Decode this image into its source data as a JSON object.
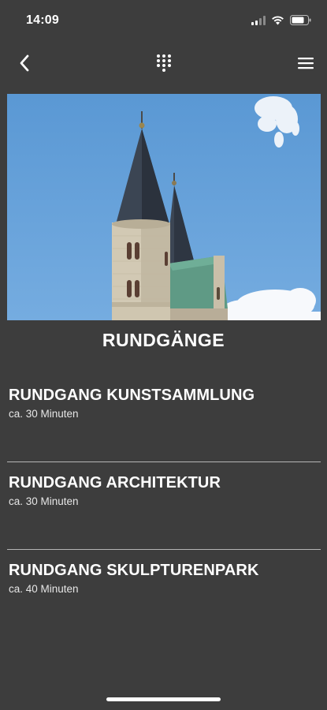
{
  "status_bar": {
    "time": "14:09",
    "signal_icon": "cellular-signal-icon",
    "wifi_icon": "wifi-icon",
    "battery_icon": "battery-icon"
  },
  "nav": {
    "back_icon": "chevron-left-icon",
    "keypad_icon": "keypad-icon",
    "menu_icon": "hamburger-menu-icon"
  },
  "hero": {
    "image": "church-towers-photo"
  },
  "section": {
    "title": "RUNDGÄNGE"
  },
  "tours": [
    {
      "title": "RUNDGANG KUNSTSAMMLUNG",
      "duration": "ca. 30 Minuten"
    },
    {
      "title": "RUNDGANG ARCHITEKTUR",
      "duration": "ca. 30 Minuten"
    },
    {
      "title": "RUNDGANG SKULPTURENPARK",
      "duration": "ca. 40 Minuten"
    }
  ],
  "colors": {
    "background": "#3d3d3d",
    "text": "#ffffff",
    "divider": "#b5b5b5",
    "sky": "#5c9bd6"
  }
}
